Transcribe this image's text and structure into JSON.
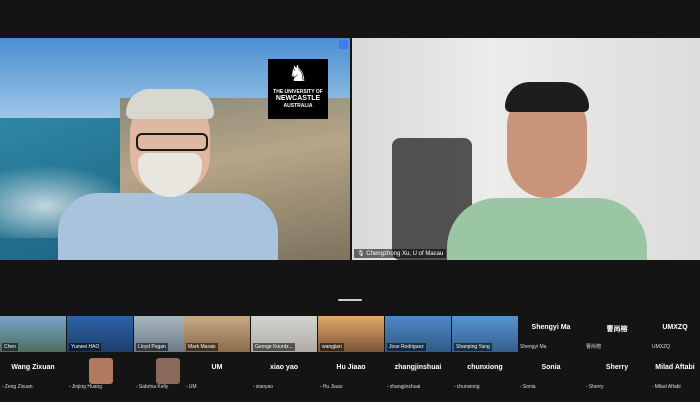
{
  "main_video": {
    "logo_lines": [
      "THE UNIVERSITY OF",
      "NEWCASTLE",
      "AUSTRALIA"
    ],
    "logo_glyph": "♞"
  },
  "speaker_video": {
    "name": "Chengzhong Xu, U of Macau"
  },
  "gallery_row1": [
    {
      "name": "Chen"
    },
    {
      "name": "Yuewei HAO"
    },
    {
      "name": "Lloyd Pogan"
    },
    {
      "name": "Mark Marais"
    },
    {
      "name": "George Kountz..."
    },
    {
      "name": "wangjian"
    },
    {
      "name": "Jose Rodriguez"
    },
    {
      "name": "Shanping Yang"
    }
  ],
  "gallery_text_row1": [
    {
      "big": "Shengyi Ma",
      "small": "Shengyi Ma"
    },
    {
      "big": "曹尚榕",
      "small": "曹尚榕"
    },
    {
      "big": "UMXZQ",
      "small": "UMXZQ"
    }
  ],
  "gallery_row2": [
    {
      "big": "Wang Zixuan",
      "small": "Zeng Zixuan",
      "avatar": false
    },
    {
      "big": "",
      "small": "Jinjing Huang",
      "avatar": true,
      "avatar_color": "#b07a5e"
    },
    {
      "big": "",
      "small": "Sabrina Kelly",
      "avatar": true,
      "avatar_color": "#8a6a5a"
    },
    {
      "big": "UM",
      "small": "UM",
      "avatar": false
    },
    {
      "big": "xiao yao",
      "small": "xiaoyao",
      "avatar": false
    },
    {
      "big": "Hu Jiaao",
      "small": "Hu Jiaao",
      "avatar": false
    },
    {
      "big": "zhangjinshuai",
      "small": "zhangjinshuai",
      "avatar": false
    },
    {
      "big": "chunxiong",
      "small": "chunxiong",
      "avatar": false
    },
    {
      "big": "Sonia",
      "small": "Sonia",
      "avatar": false
    },
    {
      "big": "Sherry",
      "small": "Sherry",
      "avatar": false
    },
    {
      "big": "Milad Aftabi",
      "small": "Milad Aftabi",
      "avatar": false
    }
  ],
  "icons": {
    "mic_muted": "mic-muted-icon",
    "mic": "mic-icon"
  },
  "colors": {
    "active_speaker": "#3ec84a",
    "muted": "#e0433b"
  }
}
